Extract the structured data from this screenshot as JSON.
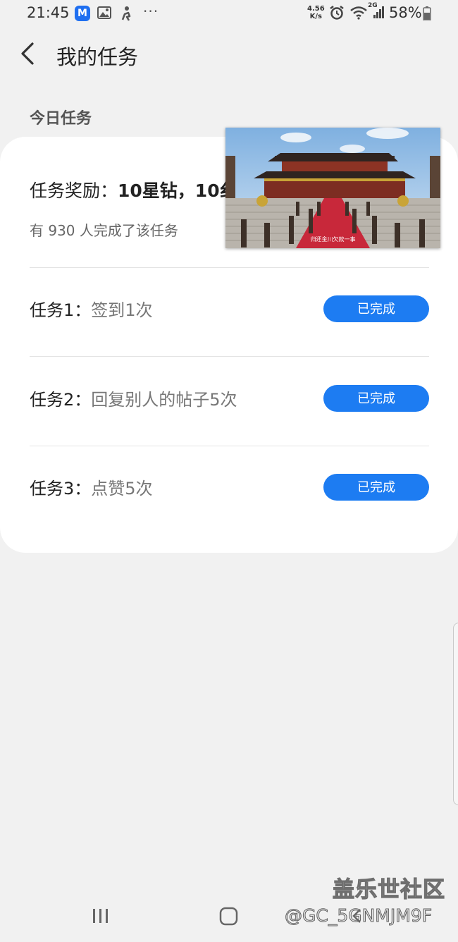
{
  "status_bar": {
    "time": "21:45",
    "app_badge": "M",
    "more": "···",
    "net_speed_value": "4.56",
    "net_speed_unit": "K/s",
    "network": "2G",
    "battery": "58%"
  },
  "header": {
    "title": "我的任务"
  },
  "section": {
    "title": "今日任务"
  },
  "reward": {
    "prefix": "任务奖励：",
    "amount": "10星钻，10纟",
    "completed_text": "有 930 人完成了该任务"
  },
  "tasks": [
    {
      "num": "任务1：",
      "desc": "签到1次",
      "status": "已完成"
    },
    {
      "num": "任务2：",
      "desc": "回复别人的帖子5次",
      "status": "已完成"
    },
    {
      "num": "任务3：",
      "desc": "点赞5次",
      "status": "已完成"
    }
  ],
  "video": {
    "caption": "归还金川欠款一事"
  },
  "watermark": {
    "site": "盖乐世社区",
    "user": "@GC_5GNMJM9F"
  },
  "colors": {
    "accent": "#1d7cf2",
    "background": "#f1f1f1",
    "card": "#ffffff"
  },
  "icons": [
    "back-arrow-icon",
    "gallery-icon",
    "activity-icon",
    "alarm-icon",
    "wifi-icon",
    "signal-icon",
    "battery-icon",
    "recents-icon",
    "home-icon",
    "back-icon"
  ]
}
